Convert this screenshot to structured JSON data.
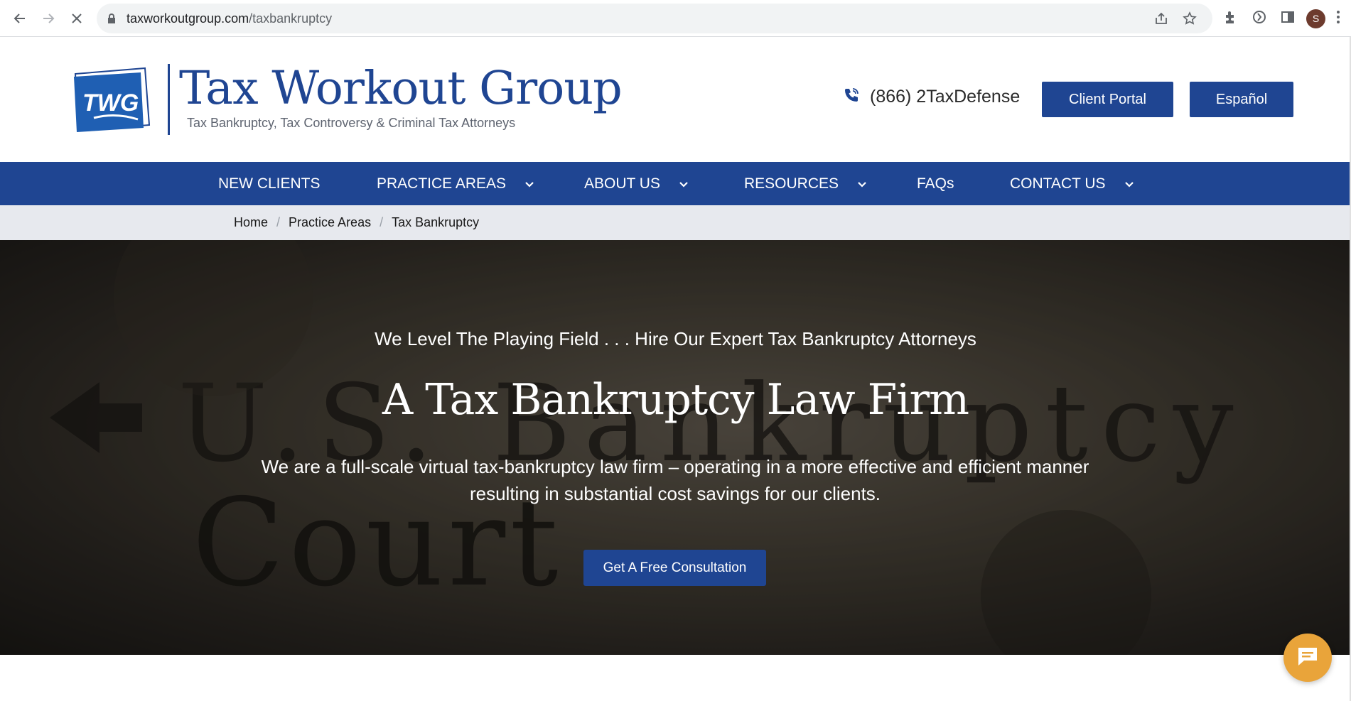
{
  "browser": {
    "url_domain": "taxworkoutgroup.com",
    "url_path": "/taxbankruptcy",
    "profile_initial": "S",
    "icons": [
      "back-icon",
      "forward-icon",
      "stop-loading-icon",
      "lock-icon",
      "share-icon",
      "bookmark-star-icon",
      "extensions-icon",
      "sync-icon",
      "side-panel-icon",
      "menu-kebab-icon"
    ]
  },
  "header": {
    "logo_text": "TWG",
    "brand_name": "Tax Workout Group",
    "tagline": "Tax Bankruptcy, Tax Controversy & Criminal Tax Attorneys",
    "phone": "(866) 2TaxDefense",
    "client_portal_label": "Client Portal",
    "espanol_label": "Español"
  },
  "nav": {
    "items": [
      {
        "label": "NEW CLIENTS",
        "dropdown": false
      },
      {
        "label": "PRACTICE AREAS",
        "dropdown": true
      },
      {
        "label": "ABOUT US",
        "dropdown": true
      },
      {
        "label": "RESOURCES",
        "dropdown": true
      },
      {
        "label": "FAQs",
        "dropdown": false
      },
      {
        "label": "CONTACT US",
        "dropdown": true
      }
    ]
  },
  "breadcrumb": {
    "items": [
      "Home",
      "Practice Areas",
      "Tax Bankruptcy"
    ],
    "separator": "/"
  },
  "hero": {
    "kicker": "We Level The Playing Field . . . Hire Our Expert Tax Bankruptcy Attorneys",
    "title": "A Tax Bankruptcy Law Firm",
    "body": "We are a full-scale virtual tax-bankruptcy law firm – operating in a more effective and efficient manner resulting in substantial cost savings for our clients.",
    "cta_label": "Get A Free Consultation",
    "background_words": [
      "U.S. Bankruptcy",
      "Court"
    ]
  },
  "colors": {
    "brand_blue": "#1f4592",
    "breadcrumb_bg": "#e7e9ee",
    "chat_orange": "#e9a43a"
  }
}
